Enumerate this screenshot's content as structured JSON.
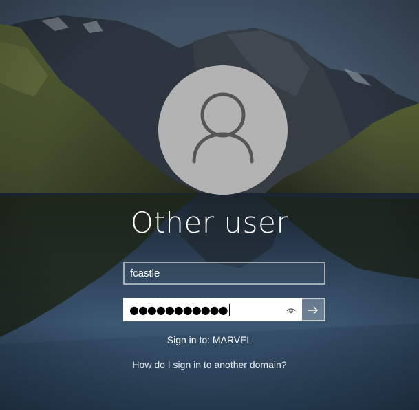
{
  "user": {
    "display_name": "Other user",
    "avatar_icon": "user-silhouette-icon"
  },
  "username_field": {
    "value": "fcastle"
  },
  "password_field": {
    "masked_value": "●●●●●●●●●●●",
    "reveal_icon": "eye-icon"
  },
  "submit": {
    "icon": "arrow-right-icon"
  },
  "signin_target": "Sign in to: MARVEL",
  "domain_help_link": "How do I sign in to another domain?",
  "colors": {
    "avatar_bg": "#b3b3b3",
    "avatar_fg": "#555555",
    "text": "#ffffff"
  }
}
